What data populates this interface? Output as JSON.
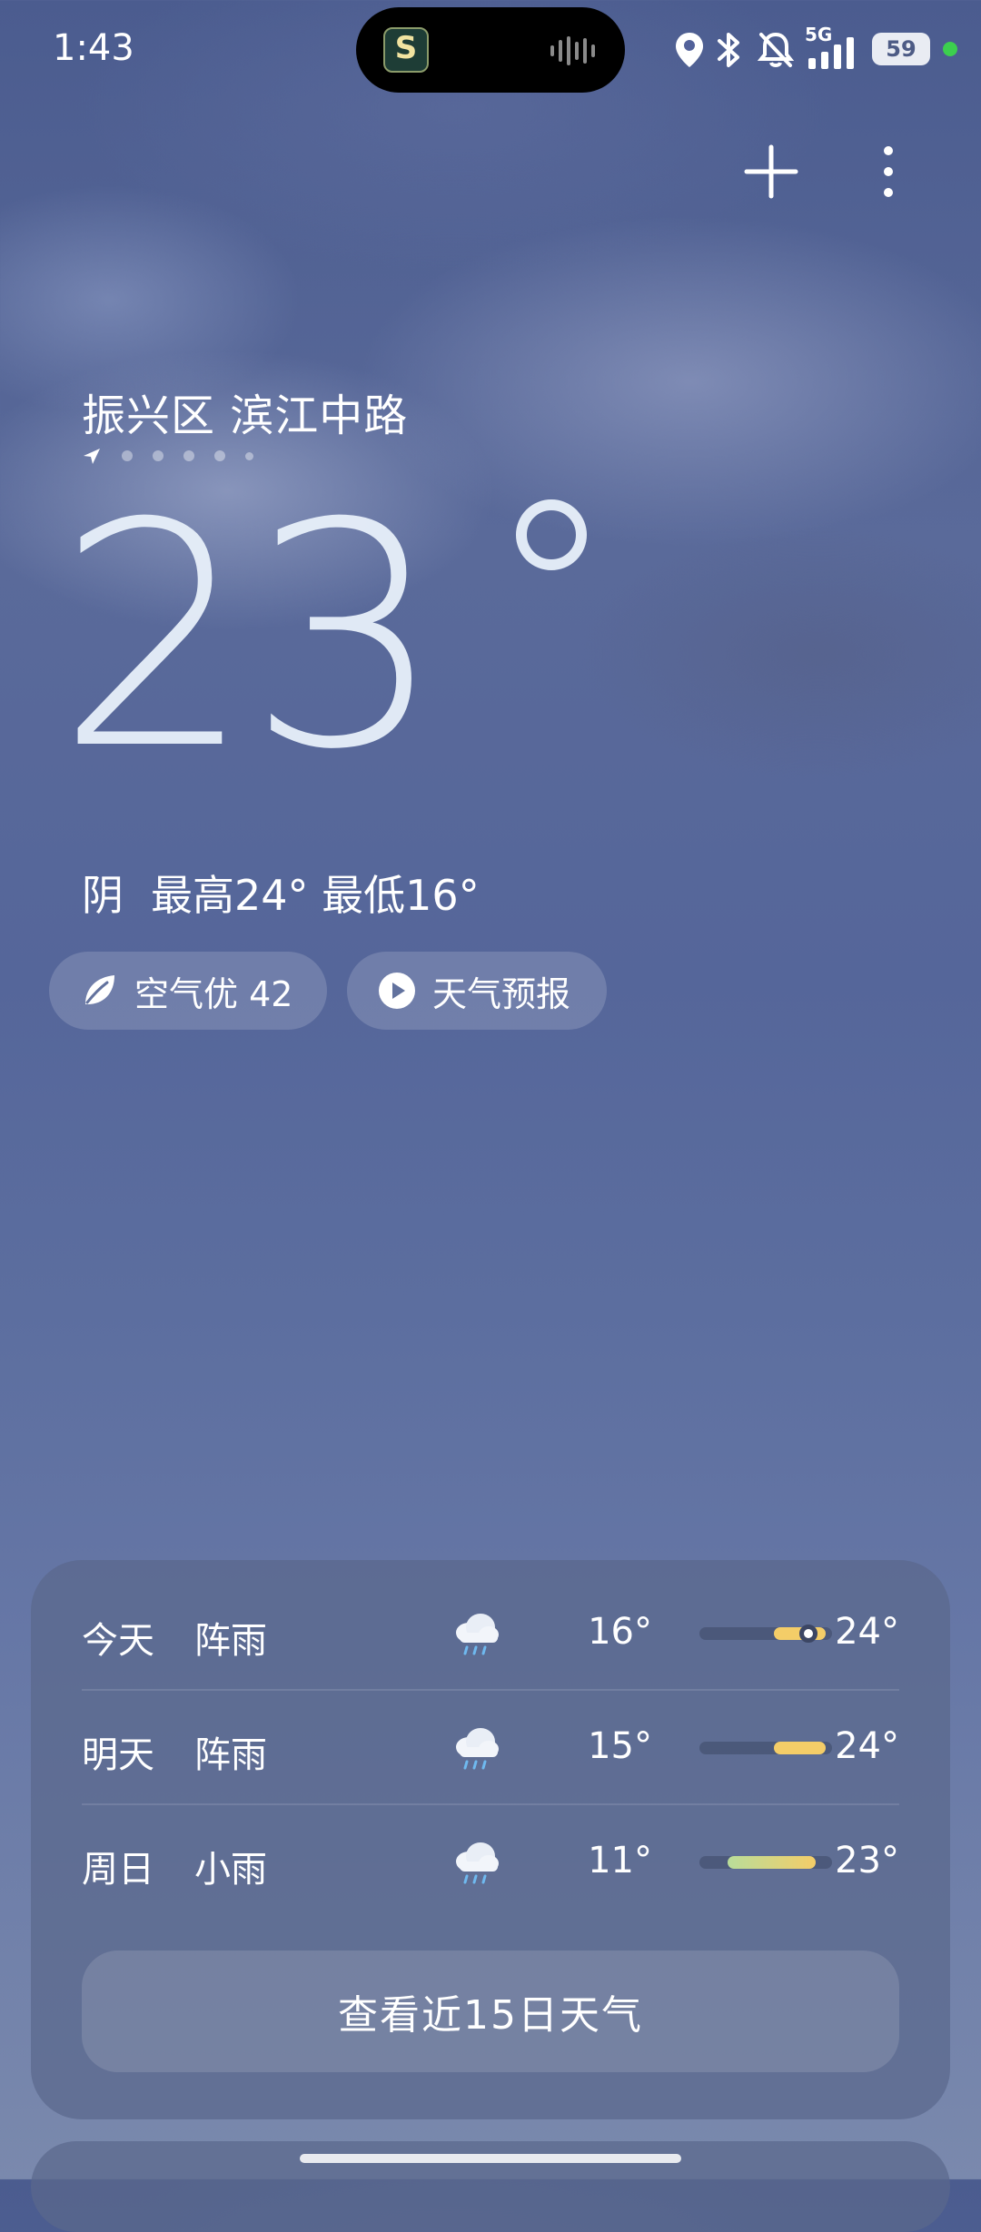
{
  "status_bar": {
    "time": "1:43",
    "battery": "59",
    "network": "5G",
    "island_app_letter": "S",
    "island_app_icon": "club-app-icon",
    "icons": [
      "location-icon",
      "bluetooth-icon",
      "mute-bell-icon",
      "signal-icon"
    ]
  },
  "header": {
    "add_icon": "plus-icon",
    "more_icon": "more-vertical-icon"
  },
  "location": {
    "name": "振兴区 滨江中路",
    "page_count": 6,
    "current_page": 1
  },
  "current": {
    "temperature": "23",
    "condition": "阴",
    "high_low": "最高24° 最低16°"
  },
  "chips": {
    "air_quality": "空气优 42",
    "forecast": "天气预报"
  },
  "daily": [
    {
      "day": "今天",
      "condition": "阵雨",
      "icon": "rain-cloud-icon",
      "low": "16°",
      "high": "24°",
      "bar_start": 0.56,
      "bar_end": 0.95,
      "current_marker": 0.82
    },
    {
      "day": "明天",
      "condition": "阵雨",
      "icon": "rain-cloud-icon",
      "low": "15°",
      "high": "24°",
      "bar_start": 0.56,
      "bar_end": 0.95
    },
    {
      "day": "周日",
      "condition": "小雨",
      "icon": "rain-cloud-icon",
      "low": "11°",
      "high": "23°",
      "bar_start": 0.21,
      "bar_end": 0.88
    }
  ],
  "more_days_button": "查看近15日天气",
  "colors": {
    "bar_warm": "#f4cd68",
    "bar_cool": "#b9dd9a",
    "background_top": "#4b5c8f",
    "background_bottom": "#7a89ad"
  }
}
